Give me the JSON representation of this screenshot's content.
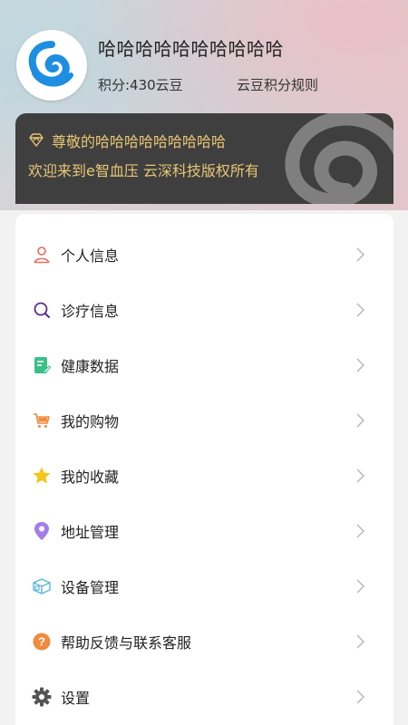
{
  "profile": {
    "username": "哈哈哈哈哈哈哈哈哈哈",
    "points": "积分:430云豆",
    "rules_link": "云豆积分规则"
  },
  "vip": {
    "greeting": "尊敬的哈哈哈哈哈哈哈哈哈",
    "welcome": "欢迎来到e智血压 云深科技版权所有",
    "text_color": "#e8c774",
    "card_color": "#3f3f3f"
  },
  "menu": {
    "items": [
      {
        "label": "个人信息",
        "icon": "user-icon"
      },
      {
        "label": "诊疗信息",
        "icon": "search-icon"
      },
      {
        "label": "健康数据",
        "icon": "health-data-icon"
      },
      {
        "label": "我的购物",
        "icon": "cart-icon"
      },
      {
        "label": "我的收藏",
        "icon": "star-icon"
      },
      {
        "label": "地址管理",
        "icon": "location-pin-icon"
      },
      {
        "label": "设备管理",
        "icon": "device-box-icon"
      },
      {
        "label": "帮助反馈与联系客服",
        "icon": "help-icon"
      },
      {
        "label": "设置",
        "icon": "gear-icon"
      }
    ]
  },
  "colors": {
    "accent_blue": "#1e8ee0",
    "user_icon": "#e96a5a",
    "search_icon": "#5a2d8c",
    "health_icon": "#3cc08a",
    "cart_icon": "#f08a3c",
    "star_icon": "#f5c518",
    "pin_icon": "#a67de8",
    "device_icon": "#5bb7d8",
    "help_icon": "#f08a3c",
    "gear_icon": "#555555"
  }
}
